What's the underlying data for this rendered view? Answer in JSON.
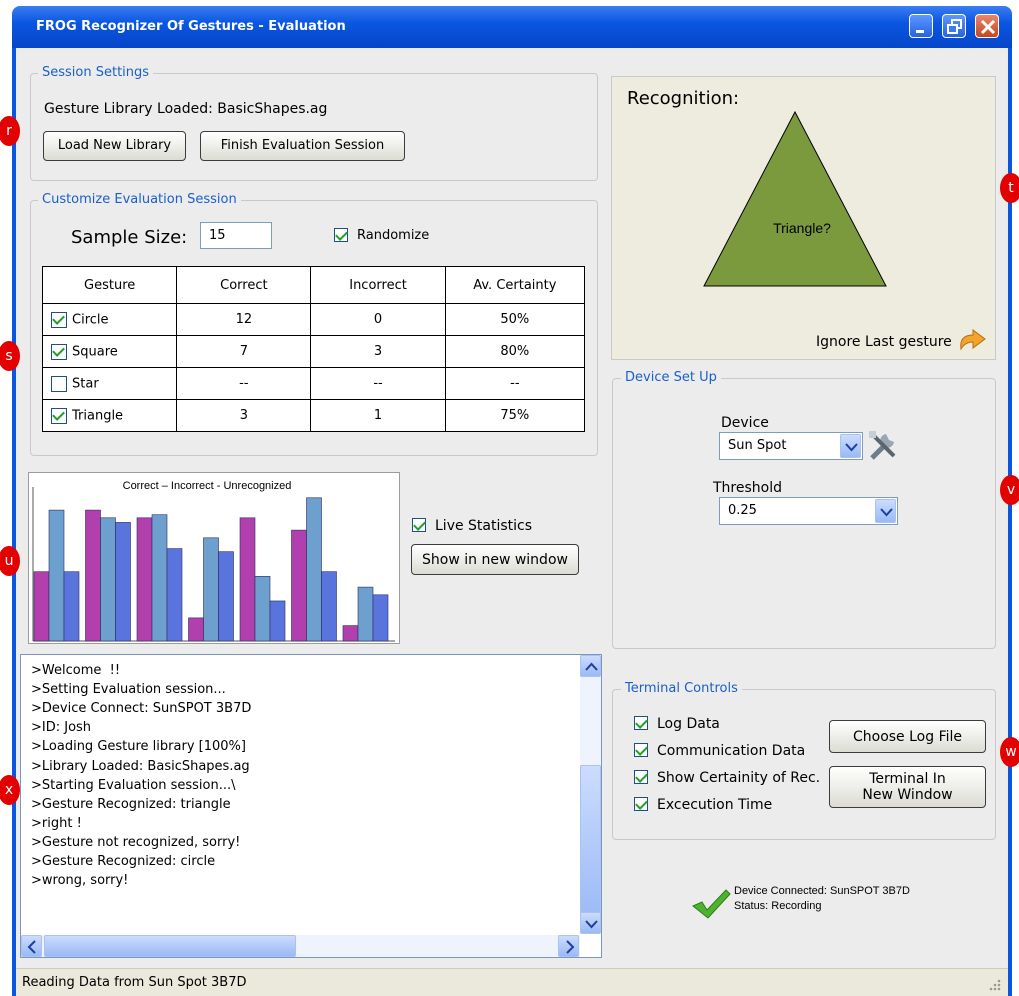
{
  "window": {
    "title": "FROG Recognizer Of Gestures - Evaluation"
  },
  "markers": {
    "r": "r",
    "s": "s",
    "t": "t",
    "u": "u",
    "v": "v",
    "w": "w",
    "x": "x"
  },
  "session_settings": {
    "legend": "Session Settings",
    "library_loaded": "Gesture Library Loaded: BasicShapes.ag",
    "load_button": "Load New Library",
    "finish_button": "Finish Evaluation Session"
  },
  "customize": {
    "legend": "Customize Evaluation Session",
    "sample_size_label": "Sample Size:",
    "sample_size_value": "15",
    "randomize_label": "Randomize",
    "randomize_checked": true,
    "columns": [
      "Gesture",
      "Correct",
      "Incorrect",
      "Av. Certainty"
    ],
    "rows": [
      {
        "gesture": "Circle",
        "checked": true,
        "correct": "12",
        "incorrect": "0",
        "certainty": "50%"
      },
      {
        "gesture": "Square",
        "checked": true,
        "correct": "7",
        "incorrect": "3",
        "certainty": "80%"
      },
      {
        "gesture": "Star",
        "checked": false,
        "correct": "--",
        "incorrect": "--",
        "certainty": "--"
      },
      {
        "gesture": "Triangle",
        "checked": true,
        "correct": "3",
        "incorrect": "1",
        "certainty": "75%"
      }
    ]
  },
  "chart_data": {
    "type": "bar",
    "title": "Correct – Incorrect - Unrecognized",
    "series": [
      {
        "color": "#b13fae",
        "values": [
          45,
          85,
          80,
          15,
          80,
          72,
          10
        ]
      },
      {
        "color": "#6d9fcf",
        "values": [
          85,
          80,
          82,
          67,
          42,
          93,
          35
        ]
      },
      {
        "color": "#5a74de",
        "values": [
          45,
          77,
          60,
          58,
          26,
          45,
          30
        ]
      }
    ],
    "ylim": [
      0,
      100
    ]
  },
  "stats": {
    "live_label": "Live Statistics",
    "live_checked": true,
    "show_window_button": "Show in new window"
  },
  "terminal": {
    "lines": [
      ">Welcome  !!",
      ">Setting Evaluation session...",
      ">Device Connect: SunSPOT 3B7D",
      ">ID: Josh",
      ">Loading Gesture library [100%]",
      ">Library Loaded: BasicShapes.ag",
      ">Starting Evaluation session...\\",
      ">Gesture Recognized: triangle",
      ">right !",
      ">Gesture not recognized, sorry!",
      ">Gesture Recognized: circle",
      ">wrong, sorry!"
    ]
  },
  "recognition": {
    "title": "Recognition:",
    "shape_label": "Triangle?",
    "ignore_label": "Ignore Last gesture",
    "shape_color": "#7a9a3d"
  },
  "device_setup": {
    "legend": "Device Set Up",
    "device_label": "Device",
    "device_value": "Sun Spot",
    "threshold_label": "Threshold",
    "threshold_value": "0.25"
  },
  "terminal_controls": {
    "legend": "Terminal Controls",
    "options": [
      {
        "label": "Log Data",
        "checked": true
      },
      {
        "label": "Communication Data",
        "checked": true
      },
      {
        "label": "Show Certainity of Rec.",
        "checked": true
      },
      {
        "label": "Excecution Time",
        "checked": true
      }
    ],
    "choose_log_button": "Choose Log File",
    "terminal_window_button": "Terminal In New Window"
  },
  "connection": {
    "line1": "Device Connected: SunSPOT 3B7D",
    "line2": "Status: Recording"
  },
  "status_bar": {
    "text": "Reading Data from Sun Spot 3B7D"
  }
}
